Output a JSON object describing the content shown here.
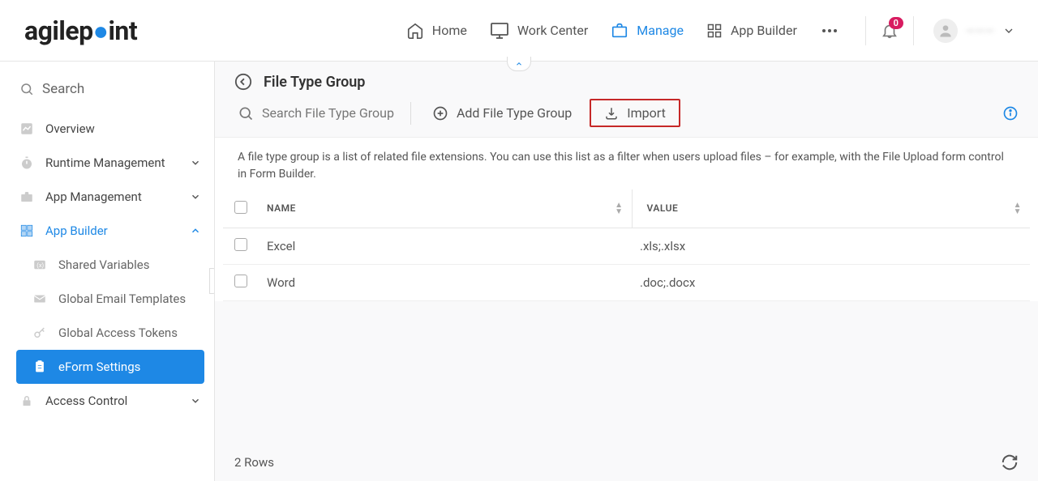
{
  "logo": {
    "prefix": "agilep",
    "suffix": "int"
  },
  "nav": {
    "home": "Home",
    "work_center": "Work Center",
    "manage": "Manage",
    "app_builder": "App Builder",
    "notif_count": "0"
  },
  "user": {
    "name": "———"
  },
  "sidebar": {
    "search_placeholder": "Search",
    "overview": "Overview",
    "runtime": "Runtime Management",
    "app_mgmt": "App Management",
    "app_builder": "App Builder",
    "shared_vars": "Shared Variables",
    "email_tpl": "Global Email Templates",
    "access_tok": "Global Access Tokens",
    "eform": "eForm Settings",
    "access_ctrl": "Access Control"
  },
  "main": {
    "title": "File Type Group",
    "search_placeholder": "Search File Type Group",
    "add_label": "Add File Type Group",
    "import_label": "Import",
    "description": "A file type group is a list of related file extensions. You can use this list as a filter when users upload files – for example, with the File Upload form control in Form Builder.",
    "col_name": "NAME",
    "col_value": "VALUE",
    "rows": [
      {
        "name": "Excel",
        "value": ".xls;.xlsx"
      },
      {
        "name": "Word",
        "value": ".doc;.docx"
      }
    ],
    "footer_count": "2 Rows"
  }
}
